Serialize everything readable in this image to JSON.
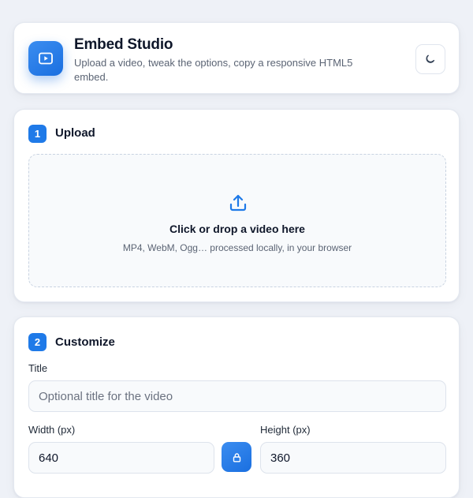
{
  "header": {
    "title": "Embed Studio",
    "subtitle": "Upload a video, tweak the options, copy a responsive HTML5 embed.",
    "logo_icon": "play-icon",
    "theme_toggle_icon": "moon-icon"
  },
  "upload": {
    "step": "1",
    "title": "Upload",
    "icon": "upload-icon",
    "drop_title": "Click or drop a video here",
    "drop_hint": "MP4, WebM, Ogg… processed locally, in your browser"
  },
  "customize": {
    "step": "2",
    "title": "Customize",
    "title_field": {
      "label": "Title",
      "placeholder": "Optional title for the video",
      "value": ""
    },
    "width_field": {
      "label": "Width (px)",
      "value": "640"
    },
    "height_field": {
      "label": "Height (px)",
      "value": "360"
    },
    "lock_icon": "lock-icon"
  },
  "colors": {
    "accent": "#1f7ae8",
    "background": "#eef1f7",
    "card": "#ffffff",
    "text": "#0f172a",
    "muted_text": "#5b6474"
  }
}
